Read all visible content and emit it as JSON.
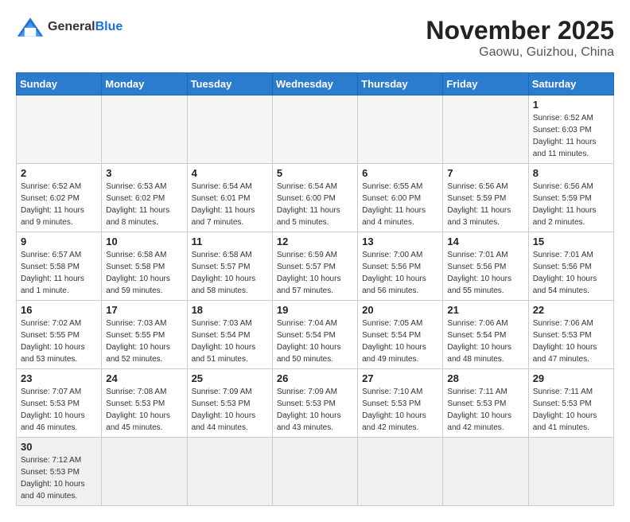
{
  "header": {
    "logo_general": "General",
    "logo_blue": "Blue",
    "month_title": "November 2025",
    "location": "Gaowu, Guizhou, China"
  },
  "weekdays": [
    "Sunday",
    "Monday",
    "Tuesday",
    "Wednesday",
    "Thursday",
    "Friday",
    "Saturday"
  ],
  "weeks": [
    [
      {
        "day": "",
        "info": ""
      },
      {
        "day": "",
        "info": ""
      },
      {
        "day": "",
        "info": ""
      },
      {
        "day": "",
        "info": ""
      },
      {
        "day": "",
        "info": ""
      },
      {
        "day": "",
        "info": ""
      },
      {
        "day": "1",
        "info": "Sunrise: 6:52 AM\nSunset: 6:03 PM\nDaylight: 11 hours and 11 minutes."
      }
    ],
    [
      {
        "day": "2",
        "info": "Sunrise: 6:52 AM\nSunset: 6:02 PM\nDaylight: 11 hours and 9 minutes."
      },
      {
        "day": "3",
        "info": "Sunrise: 6:53 AM\nSunset: 6:02 PM\nDaylight: 11 hours and 8 minutes."
      },
      {
        "day": "4",
        "info": "Sunrise: 6:54 AM\nSunset: 6:01 PM\nDaylight: 11 hours and 7 minutes."
      },
      {
        "day": "5",
        "info": "Sunrise: 6:54 AM\nSunset: 6:00 PM\nDaylight: 11 hours and 5 minutes."
      },
      {
        "day": "6",
        "info": "Sunrise: 6:55 AM\nSunset: 6:00 PM\nDaylight: 11 hours and 4 minutes."
      },
      {
        "day": "7",
        "info": "Sunrise: 6:56 AM\nSunset: 5:59 PM\nDaylight: 11 hours and 3 minutes."
      },
      {
        "day": "8",
        "info": "Sunrise: 6:56 AM\nSunset: 5:59 PM\nDaylight: 11 hours and 2 minutes."
      }
    ],
    [
      {
        "day": "9",
        "info": "Sunrise: 6:57 AM\nSunset: 5:58 PM\nDaylight: 11 hours and 1 minute."
      },
      {
        "day": "10",
        "info": "Sunrise: 6:58 AM\nSunset: 5:58 PM\nDaylight: 10 hours and 59 minutes."
      },
      {
        "day": "11",
        "info": "Sunrise: 6:58 AM\nSunset: 5:57 PM\nDaylight: 10 hours and 58 minutes."
      },
      {
        "day": "12",
        "info": "Sunrise: 6:59 AM\nSunset: 5:57 PM\nDaylight: 10 hours and 57 minutes."
      },
      {
        "day": "13",
        "info": "Sunrise: 7:00 AM\nSunset: 5:56 PM\nDaylight: 10 hours and 56 minutes."
      },
      {
        "day": "14",
        "info": "Sunrise: 7:01 AM\nSunset: 5:56 PM\nDaylight: 10 hours and 55 minutes."
      },
      {
        "day": "15",
        "info": "Sunrise: 7:01 AM\nSunset: 5:56 PM\nDaylight: 10 hours and 54 minutes."
      }
    ],
    [
      {
        "day": "16",
        "info": "Sunrise: 7:02 AM\nSunset: 5:55 PM\nDaylight: 10 hours and 53 minutes."
      },
      {
        "day": "17",
        "info": "Sunrise: 7:03 AM\nSunset: 5:55 PM\nDaylight: 10 hours and 52 minutes."
      },
      {
        "day": "18",
        "info": "Sunrise: 7:03 AM\nSunset: 5:54 PM\nDaylight: 10 hours and 51 minutes."
      },
      {
        "day": "19",
        "info": "Sunrise: 7:04 AM\nSunset: 5:54 PM\nDaylight: 10 hours and 50 minutes."
      },
      {
        "day": "20",
        "info": "Sunrise: 7:05 AM\nSunset: 5:54 PM\nDaylight: 10 hours and 49 minutes."
      },
      {
        "day": "21",
        "info": "Sunrise: 7:06 AM\nSunset: 5:54 PM\nDaylight: 10 hours and 48 minutes."
      },
      {
        "day": "22",
        "info": "Sunrise: 7:06 AM\nSunset: 5:53 PM\nDaylight: 10 hours and 47 minutes."
      }
    ],
    [
      {
        "day": "23",
        "info": "Sunrise: 7:07 AM\nSunset: 5:53 PM\nDaylight: 10 hours and 46 minutes."
      },
      {
        "day": "24",
        "info": "Sunrise: 7:08 AM\nSunset: 5:53 PM\nDaylight: 10 hours and 45 minutes."
      },
      {
        "day": "25",
        "info": "Sunrise: 7:09 AM\nSunset: 5:53 PM\nDaylight: 10 hours and 44 minutes."
      },
      {
        "day": "26",
        "info": "Sunrise: 7:09 AM\nSunset: 5:53 PM\nDaylight: 10 hours and 43 minutes."
      },
      {
        "day": "27",
        "info": "Sunrise: 7:10 AM\nSunset: 5:53 PM\nDaylight: 10 hours and 42 minutes."
      },
      {
        "day": "28",
        "info": "Sunrise: 7:11 AM\nSunset: 5:53 PM\nDaylight: 10 hours and 42 minutes."
      },
      {
        "day": "29",
        "info": "Sunrise: 7:11 AM\nSunset: 5:53 PM\nDaylight: 10 hours and 41 minutes."
      }
    ],
    [
      {
        "day": "30",
        "info": "Sunrise: 7:12 AM\nSunset: 5:53 PM\nDaylight: 10 hours and 40 minutes."
      },
      {
        "day": "",
        "info": ""
      },
      {
        "day": "",
        "info": ""
      },
      {
        "day": "",
        "info": ""
      },
      {
        "day": "",
        "info": ""
      },
      {
        "day": "",
        "info": ""
      },
      {
        "day": "",
        "info": ""
      }
    ]
  ]
}
